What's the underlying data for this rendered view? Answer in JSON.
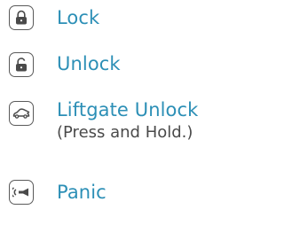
{
  "controls": [
    {
      "label": "Lock",
      "icon": "lock-closed-icon"
    },
    {
      "label": "Unlock",
      "icon": "lock-open-icon"
    },
    {
      "label": "Liftgate Unlock",
      "note": "(Press and Hold.)",
      "icon": "liftgate-icon"
    },
    {
      "label": "Panic",
      "icon": "horn-icon"
    }
  ],
  "colors": {
    "label": "#2c8fb6",
    "note": "#4a4a4a",
    "icon": "#5a5a5a"
  }
}
